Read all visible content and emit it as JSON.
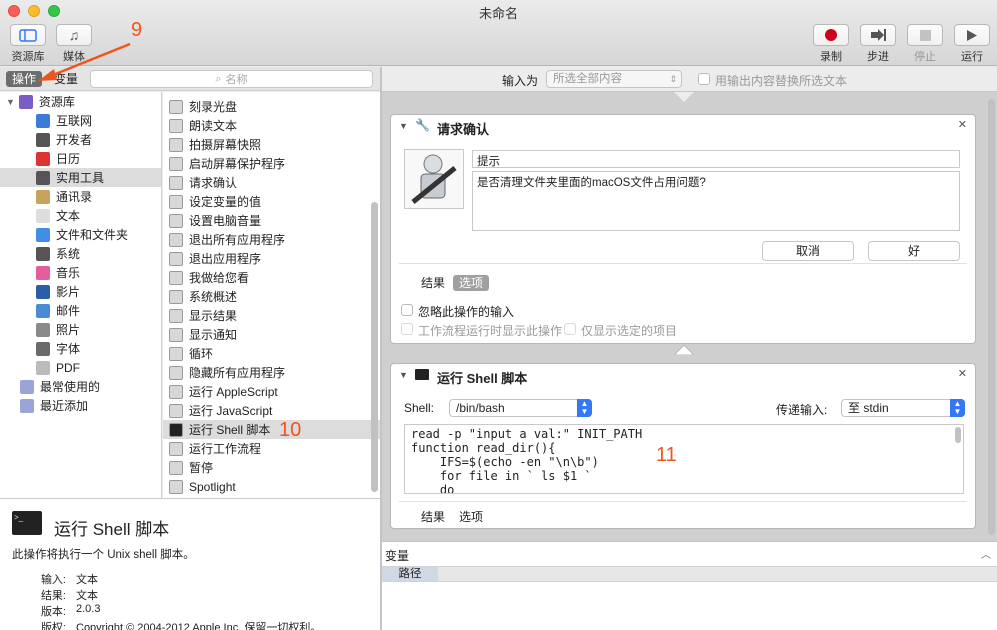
{
  "window": {
    "title": "未命名"
  },
  "toolbar": {
    "library_label": "资源库",
    "media_label": "媒体",
    "record_label": "录制",
    "step_label": "步进",
    "stop_label": "停止",
    "run_label": "运行"
  },
  "left_tabs": {
    "actions": "操作",
    "variables": "变量",
    "search_placeholder": "名称"
  },
  "library": {
    "root": "资源库",
    "items": [
      "互联网",
      "开发者",
      "日历",
      "实用工具",
      "通讯录",
      "文本",
      "文件和文件夹",
      "系统",
      "音乐",
      "影片",
      "邮件",
      "照片",
      "字体",
      "PDF"
    ],
    "selected": "实用工具",
    "groups": [
      "最常使用的",
      "最近添加"
    ]
  },
  "actions": {
    "items": [
      "刻录光盘",
      "朗读文本",
      "拍摄屏幕快照",
      "启动屏幕保护程序",
      "请求确认",
      "设定变量的值",
      "设置电脑音量",
      "退出所有应用程序",
      "退出应用程序",
      "我做给您看",
      "系统概述",
      "显示结果",
      "显示通知",
      "循环",
      "隐藏所有应用程序",
      "运行 AppleScript",
      "运行 JavaScript",
      "运行 Shell 脚本",
      "运行工作流程",
      "暂停",
      "Spotlight"
    ],
    "selected": "运行 Shell 脚本"
  },
  "description": {
    "title": "运行 Shell 脚本",
    "text": "此操作将执行一个 Unix shell 脚本。",
    "meta": [
      {
        "k": "输入:",
        "v": "文本"
      },
      {
        "k": "结果:",
        "v": "文本"
      },
      {
        "k": "版本:",
        "v": "2.0.3"
      },
      {
        "k": "版权:",
        "v": "Copyright © 2004-2012 Apple Inc. 保留一切权利。"
      }
    ]
  },
  "workflow": {
    "input_label": "输入为",
    "input_value": "所选全部内容",
    "replace_label": "用输出内容替换所选文本"
  },
  "confirm_action": {
    "title": "请求确认",
    "prompt_value": "提示",
    "message": "是否清理文件夹里面的macOS文件占用问题?",
    "cancel": "取消",
    "ok": "好",
    "tab_results": "结果",
    "tab_options": "选项",
    "opt_ignore": "忽略此操作的输入",
    "opt_show": "工作流程运行时显示此操作",
    "opt_selected": "仅显示选定的项目"
  },
  "shell_action": {
    "title": "运行 Shell 脚本",
    "shell_label": "Shell:",
    "shell_value": "/bin/bash",
    "pass_label": "传递输入:",
    "pass_value": "至 stdin",
    "script_lines": [
      "read -p \"input a val:\" INIT_PATH",
      "function read_dir(){",
      "    IFS=$(echo -en \"\\n\\b\")",
      "    for file in ` ls $1 `",
      "    do"
    ],
    "tab_results": "结果",
    "tab_options": "选项"
  },
  "variables_pane": {
    "title": "变量",
    "column": "路径"
  },
  "annotations": {
    "a9": "9",
    "a10": "10",
    "a11": "11"
  },
  "colors": {
    "accent": "#3478f6",
    "record": "#d0021b",
    "annotation": "#f0541c"
  }
}
